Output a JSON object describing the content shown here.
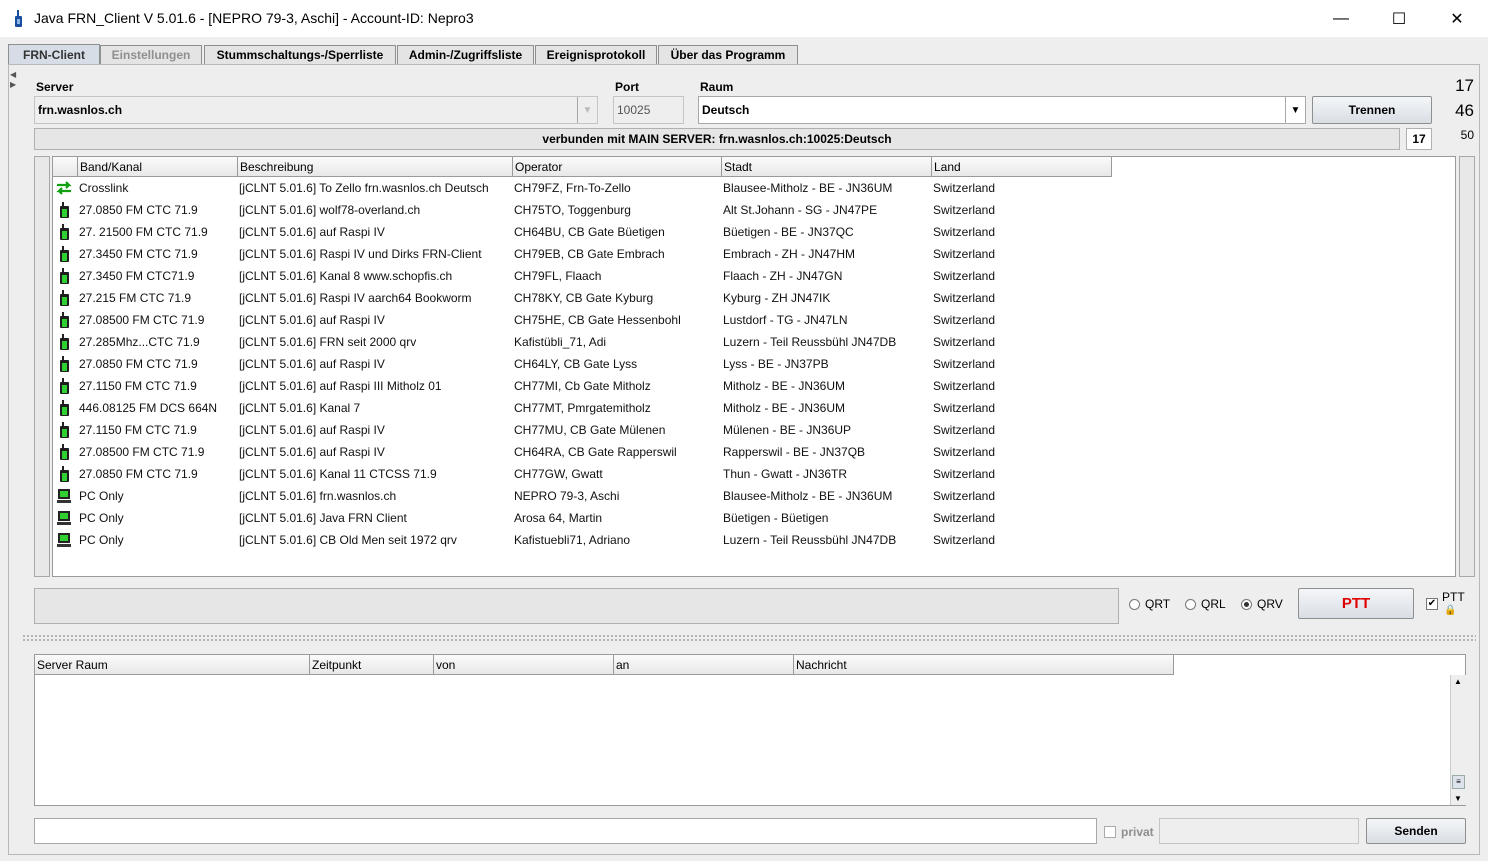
{
  "window": {
    "title": "Java FRN_Client V 5.01.6 - [NEPRO 79-3, Aschi] - Account-ID: Nepro3",
    "minimize": "—",
    "maximize": "☐",
    "close": "✕"
  },
  "tabs": [
    {
      "label": "FRN-Client",
      "active": true
    },
    {
      "label": "Einstellungen",
      "disabled": true
    },
    {
      "label": "Stummschaltungs-/Sperrliste"
    },
    {
      "label": "Admin-/Zugriffsliste"
    },
    {
      "label": "Ereignisprotokoll"
    },
    {
      "label": "Über das Programm"
    }
  ],
  "connection": {
    "server_label": "Server",
    "server_value": "frn.wasnlos.ch",
    "port_label": "Port",
    "port_value": "10025",
    "room_label": "Raum",
    "room_value": "Deutsch",
    "disconnect_button": "Trennen",
    "count_top": "17",
    "count_mid": "46",
    "count_small": "50",
    "status_text": "verbunden mit  MAIN SERVER: frn.wasnlos.ch:10025:Deutsch",
    "status_count": "17"
  },
  "user_table": {
    "columns": [
      "Band/Kanal",
      "Beschreibung",
      "Operator",
      "Stadt",
      "Land"
    ],
    "rows": [
      {
        "icon": "crosslink-icon",
        "band": "Crosslink",
        "desc": "[jCLNT 5.01.6] To Zello frn.wasnlos.ch Deutsch",
        "op": "CH79FZ, Frn-To-Zello",
        "city": "Blausee-Mitholz - BE - JN36UM",
        "country": "Switzerland"
      },
      {
        "icon": "radio-icon",
        "band": "27.0850 FM CTC 71.9",
        "desc": "[jCLNT 5.01.6] wolf78-overland.ch",
        "op": "CH75TO, Toggenburg",
        "city": "Alt St.Johann - SG - JN47PE",
        "country": "Switzerland"
      },
      {
        "icon": "radio-icon",
        "band": "27. 21500 FM CTC 71.9",
        "desc": "[jCLNT 5.01.6] auf Raspi IV",
        "op": "CH64BU, CB Gate Büetigen",
        "city": "Büetigen - BE - JN37QC",
        "country": "Switzerland"
      },
      {
        "icon": "radio-icon",
        "band": "27.3450 FM CTC 71.9",
        "desc": "[jCLNT 5.01.6] Raspi IV und Dirks FRN-Client",
        "op": "CH79EB, CB Gate Embrach",
        "city": "Embrach - ZH - JN47HM",
        "country": "Switzerland"
      },
      {
        "icon": "radio-icon",
        "band": "27.3450 FM CTC71.9",
        "desc": "[jCLNT 5.01.6] Kanal 8  www.schopfis.ch",
        "op": "CH79FL, Flaach",
        "city": "Flaach - ZH - JN47GN",
        "country": "Switzerland"
      },
      {
        "icon": "radio-icon",
        "band": "27.215 FM CTC 71.9",
        "desc": "[jCLNT 5.01.6] Raspi IV aarch64 Bookworm",
        "op": "CH78KY, CB Gate Kyburg",
        "city": "Kyburg - ZH JN47IK",
        "country": "Switzerland"
      },
      {
        "icon": "radio-icon",
        "band": "27.08500 FM CTC 71.9",
        "desc": "[jCLNT 5.01.6] auf Raspi IV",
        "op": "CH75HE, CB Gate Hessenbohl",
        "city": "Lustdorf - TG - JN47LN",
        "country": "Switzerland"
      },
      {
        "icon": "radio-icon",
        "band": "27.285Mhz...CTC 71.9",
        "desc": "[jCLNT 5.01.6] FRN seit 2000 qrv",
        "op": "Kafistübli_71, Adi",
        "city": "Luzern - Teil Reussbühl JN47DB",
        "country": "Switzerland"
      },
      {
        "icon": "radio-icon",
        "band": "27.0850 FM CTC 71.9",
        "desc": "[jCLNT 5.01.6] auf Raspi IV",
        "op": "CH64LY, CB Gate Lyss",
        "city": "Lyss - BE - JN37PB",
        "country": "Switzerland"
      },
      {
        "icon": "radio-icon",
        "band": "27.1150 FM CTC 71.9",
        "desc": "[jCLNT 5.01.6] auf Raspi III  Mitholz 01",
        "op": "CH77MI, Cb Gate Mitholz",
        "city": "Mitholz - BE - JN36UM",
        "country": "Switzerland"
      },
      {
        "icon": "radio-icon",
        "band": "446.08125 FM DCS 664N",
        "desc": "[jCLNT 5.01.6] Kanal 7",
        "op": "CH77MT, Pmrgatemitholz",
        "city": "Mitholz - BE - JN36UM",
        "country": "Switzerland"
      },
      {
        "icon": "radio-icon",
        "band": "27.1150 FM CTC 71.9",
        "desc": "[jCLNT 5.01.6] auf Raspi IV",
        "op": "CH77MU, CB Gate Mülenen",
        "city": "Mülenen - BE - JN36UP",
        "country": "Switzerland"
      },
      {
        "icon": "radio-icon",
        "band": "27.08500 FM CTC 71.9",
        "desc": "[jCLNT 5.01.6] auf Raspi IV",
        "op": "CH64RA, CB Gate Rapperswil",
        "city": "Rapperswil - BE - JN37QB",
        "country": "Switzerland"
      },
      {
        "icon": "radio-icon",
        "band": "27.0850 FM CTC 71.9",
        "desc": "[jCLNT 5.01.6] Kanal 11 CTCSS 71.9",
        "op": "CH77GW, Gwatt",
        "city": "Thun - Gwatt - JN36TR",
        "country": "Switzerland"
      },
      {
        "icon": "pc-icon",
        "band": "PC Only",
        "desc": "[jCLNT 5.01.6] frn.wasnlos.ch",
        "op": "NEPRO 79-3, Aschi",
        "city": "Blausee-Mitholz - BE - JN36UM",
        "country": "Switzerland"
      },
      {
        "icon": "pc-icon",
        "band": "PC Only",
        "desc": "[jCLNT 5.01.6] Java FRN Client",
        "op": "Arosa 64, Martin",
        "city": "Büetigen - Büetigen",
        "country": "Switzerland"
      },
      {
        "icon": "pc-icon",
        "band": "PC Only",
        "desc": "[jCLNT 5.01.6] CB Old Men seit 1972 qrv",
        "op": "Kafistuebli71, Adriano",
        "city": "Luzern - Teil Reussbühl JN47DB",
        "country": "Switzerland"
      }
    ]
  },
  "controls": {
    "qrt": "QRT",
    "qrl": "QRL",
    "qrv": "QRV",
    "selected": "QRV",
    "ptt_button": "PTT",
    "ptt_lock_label": "PTT",
    "ptt_color": "#e00000"
  },
  "message_table": {
    "columns": [
      "Server Raum",
      "Zeitpunkt",
      "von",
      "an",
      "Nachricht"
    ]
  },
  "compose": {
    "message_value": "",
    "private_label": "privat",
    "send_button": "Senden"
  }
}
